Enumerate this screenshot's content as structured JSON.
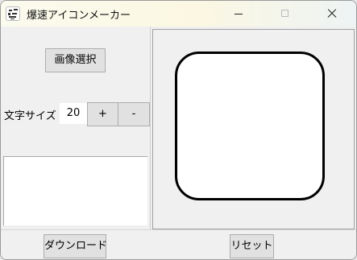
{
  "window": {
    "title": "爆速アイコンメーカー",
    "app_icon": "app-logo-icon",
    "controls": [
      "minimize-icon",
      "maximize-icon",
      "close-icon"
    ]
  },
  "left_panel": {
    "image_select_label": "画像選択",
    "font_size_label": "文字サイズ",
    "font_size_value": "20",
    "plus_label": "+",
    "minus_label": "-",
    "text_input_value": ""
  },
  "bottom": {
    "download_label": "ダウンロード",
    "reset_label": "リセット"
  },
  "colors": {
    "window_bg": "#f0f0f0",
    "button_bg": "#e1e1e1",
    "preview_border": "#000000"
  }
}
